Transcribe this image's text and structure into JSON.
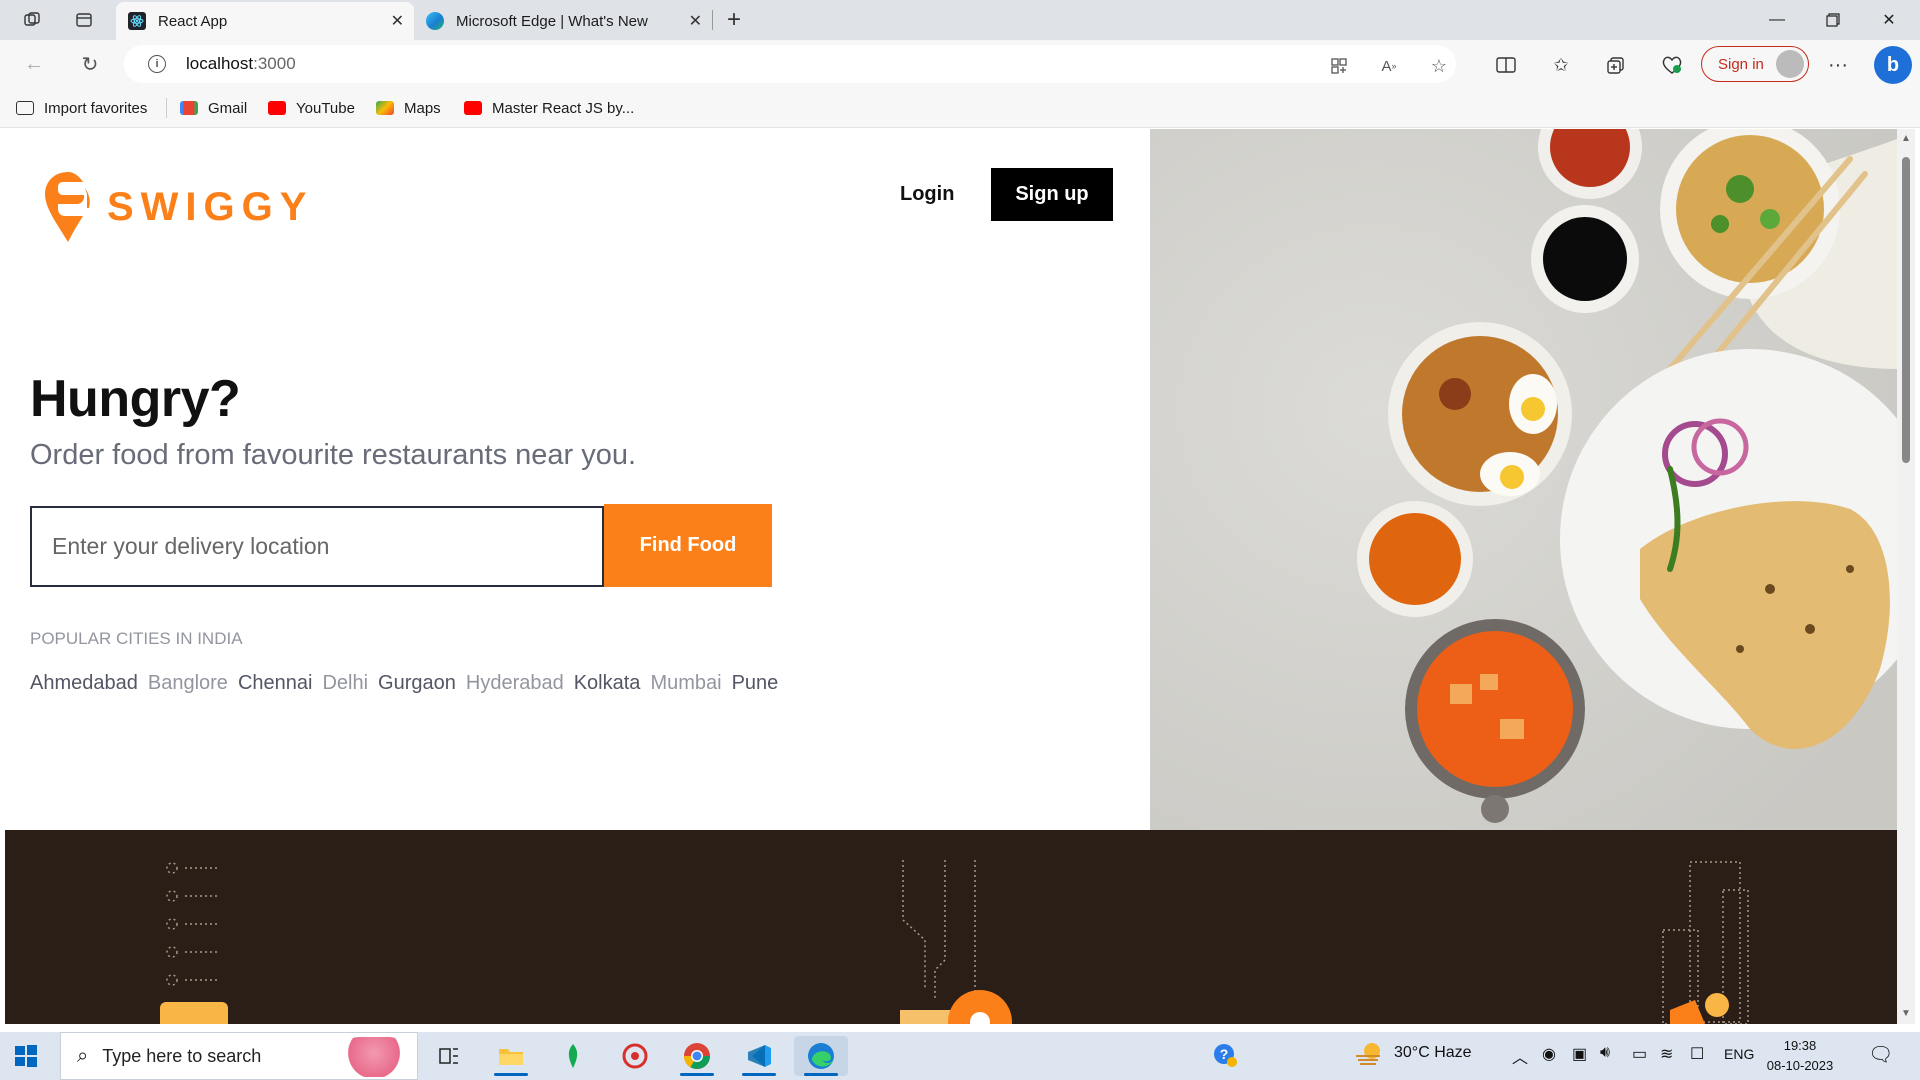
{
  "browser": {
    "tabs": [
      {
        "title": "React App",
        "active": true
      },
      {
        "title": "Microsoft Edge | What's New",
        "active": false
      }
    ],
    "address": {
      "host": "localhost",
      "port": ":3000"
    },
    "signin_label": "Sign in",
    "favorites": [
      {
        "label": "Import favorites",
        "icon": "import-icon"
      },
      {
        "label": "Gmail",
        "icon": "gmail-icon"
      },
      {
        "label": "YouTube",
        "icon": "youtube-icon"
      },
      {
        "label": "Maps",
        "icon": "maps-icon"
      },
      {
        "label": "Master React JS by...",
        "icon": "youtube-icon"
      }
    ]
  },
  "page": {
    "brand": "SWIGGY",
    "login_label": "Login",
    "signup_label": "Sign up",
    "headline": "Hungry?",
    "subheadline": "Order food from favourite restaurants near you.",
    "location_placeholder": "Enter your delivery location",
    "find_food_label": "Find Food",
    "cities_title": "POPULAR CITIES IN INDIA",
    "cities": [
      {
        "name": "Ahmedabad",
        "tone": "dark"
      },
      {
        "name": "Banglore",
        "tone": "light"
      },
      {
        "name": "Chennai",
        "tone": "dark"
      },
      {
        "name": "Delhi",
        "tone": "light"
      },
      {
        "name": "Gurgaon",
        "tone": "dark"
      },
      {
        "name": "Hyderabad",
        "tone": "light"
      },
      {
        "name": "Kolkata",
        "tone": "dark"
      },
      {
        "name": "Mumbai",
        "tone": "light"
      },
      {
        "name": "Pune",
        "tone": "dark"
      }
    ],
    "colors": {
      "brand_orange": "#fc8019",
      "band_dark": "#2b1e16"
    }
  },
  "taskbar": {
    "search_placeholder": "Type here to search",
    "weather": "30°C  Haze",
    "language": "ENG",
    "time": "19:38",
    "date": "08-10-2023"
  }
}
